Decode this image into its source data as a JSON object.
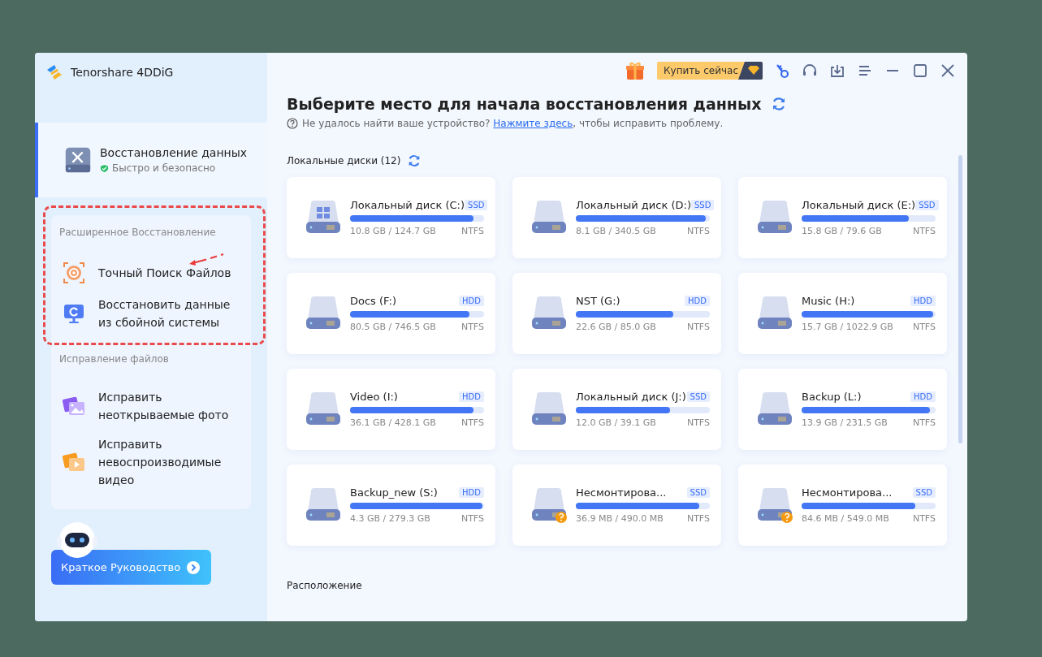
{
  "app": {
    "name": "Tenorshare 4DDiG"
  },
  "sidebar": {
    "main_item": {
      "title": "Восстановление данных",
      "subtitle": "Быстро и безопасно",
      "selected": true
    },
    "sections": [
      {
        "heading": "Расширенное Восстановление",
        "highlighted": true,
        "items": [
          {
            "kind": "target",
            "label": "Точный Поиск Файлов"
          },
          {
            "kind": "monitor",
            "label": "Восстановить данные из сбойной системы"
          }
        ]
      },
      {
        "heading": "Исправление файлов",
        "highlighted": false,
        "items": [
          {
            "kind": "photo",
            "label": "Исправить неоткрываемые фото"
          },
          {
            "kind": "video",
            "label": "Исправить невоспроизводимые видео"
          }
        ]
      }
    ],
    "guide_button": "Краткое Руководство"
  },
  "toolbar": {
    "buy_button": "Купить сейчас"
  },
  "main": {
    "title": "Выберите место для начала восстановления данных",
    "hint_before": "Не удалось найти ваше устройство?",
    "hint_link": "Нажмите здесь",
    "hint_after": ", чтобы исправить проблему.",
    "drives_heading": "Локальные диски (12)",
    "drives": [
      {
        "kind": "system",
        "name": "Локальный диск (C:)",
        "type": "SSD",
        "usage": "10.8 GB / 124.7 GB",
        "fs": "NTFS",
        "level": 0.92
      },
      {
        "kind": "plain",
        "name": "Локальный диск (D:)",
        "type": "SSD",
        "usage": "8.1 GB / 340.5 GB",
        "fs": "NTFS",
        "level": 0.97
      },
      {
        "kind": "plain",
        "name": "Локальный диск (E:)",
        "type": "SSD",
        "usage": "15.8 GB / 79.6 GB",
        "fs": "NTFS",
        "level": 0.8
      },
      {
        "kind": "plain",
        "name": "Docs (F:)",
        "type": "HDD",
        "usage": "80.5 GB / 746.5 GB",
        "fs": "NTFS",
        "level": 0.89
      },
      {
        "kind": "plain",
        "name": "NST (G:)",
        "type": "HDD",
        "usage": "22.6 GB / 85.0 GB",
        "fs": "NTFS",
        "level": 0.73
      },
      {
        "kind": "plain",
        "name": "Music (H:)",
        "type": "HDD",
        "usage": "15.7 GB / 1022.9 GB",
        "fs": "NTFS",
        "level": 0.98
      },
      {
        "kind": "plain",
        "name": "Video (I:)",
        "type": "HDD",
        "usage": "36.1 GB / 428.1 GB",
        "fs": "NTFS",
        "level": 0.92
      },
      {
        "kind": "plain",
        "name": "Локальный диск (J:)",
        "type": "SSD",
        "usage": "12.0 GB / 39.1 GB",
        "fs": "NTFS",
        "level": 0.7
      },
      {
        "kind": "plain",
        "name": "Backup (L:)",
        "type": "HDD",
        "usage": "13.9 GB / 231.5 GB",
        "fs": "NTFS",
        "level": 0.96
      },
      {
        "kind": "plain",
        "name": "Backup_new (S:)",
        "type": "HDD",
        "usage": "4.3 GB / 279.3 GB",
        "fs": "NTFS",
        "level": 0.99
      },
      {
        "kind": "unmounted",
        "name": "Несмонтирова...",
        "type": "SSD",
        "usage": "36.9 MB / 490.0 MB",
        "fs": "NTFS",
        "level": 0.92
      },
      {
        "kind": "unmounted",
        "name": "Несмонтирова...",
        "type": "SSD",
        "usage": "84.6 MB / 549.0 MB",
        "fs": "NTFS",
        "level": 0.85
      }
    ],
    "location_heading": "Расположение"
  }
}
